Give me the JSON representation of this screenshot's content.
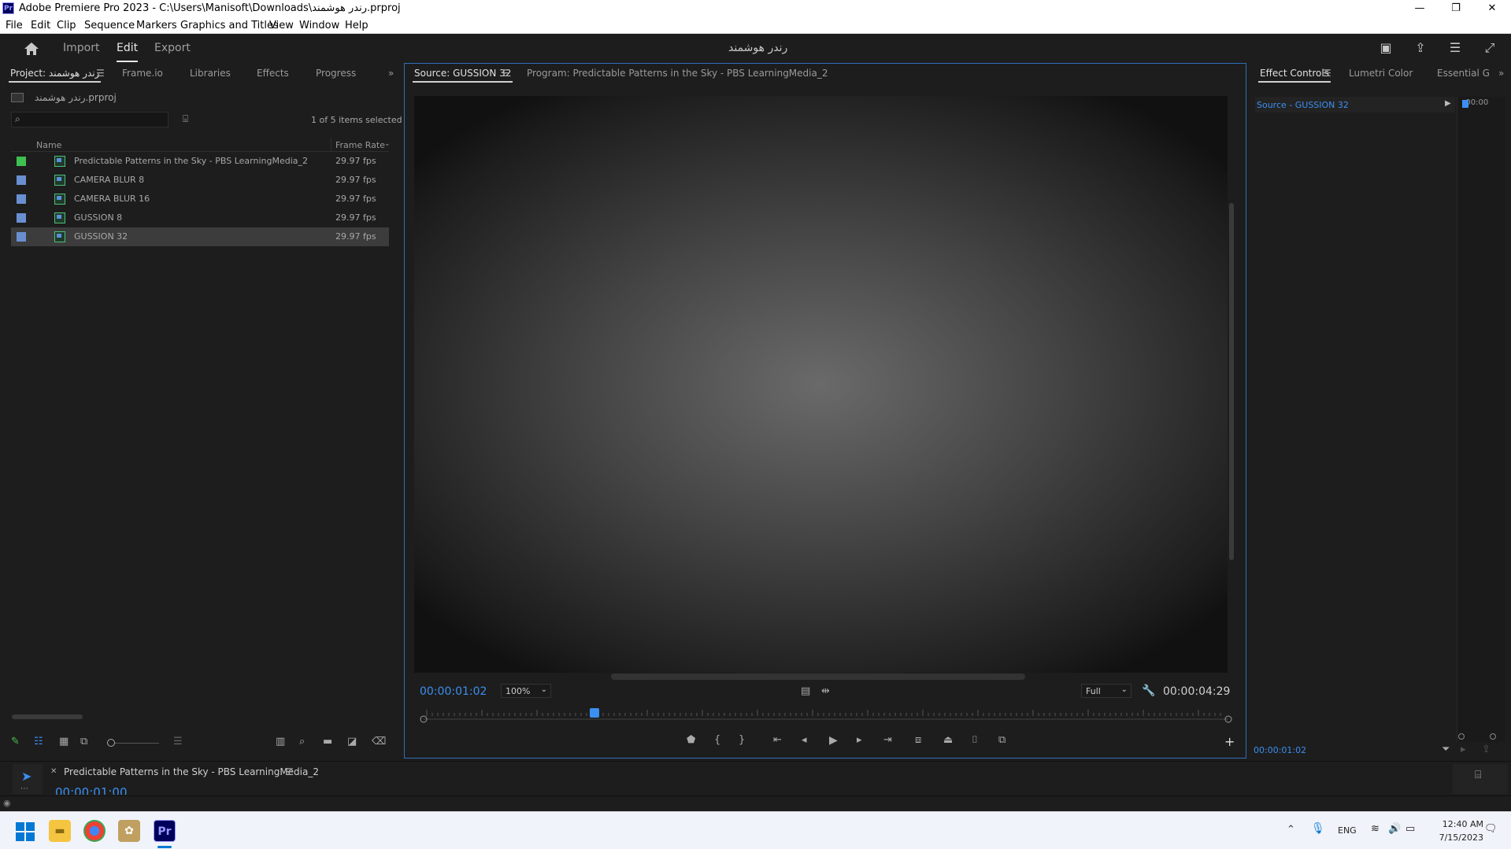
{
  "window": {
    "app_icon": "Pr",
    "title": "Adobe Premiere Pro 2023 - C:\\Users\\Manisoft\\Downloads\\رندر هوشمند.prproj",
    "minimize": "—",
    "maximize": "❐",
    "close": "✕"
  },
  "menu": [
    "File",
    "Edit",
    "Clip",
    "Sequence",
    "Markers",
    "Graphics and Titles",
    "View",
    "Window",
    "Help"
  ],
  "header": {
    "workspaces": [
      "Import",
      "Edit",
      "Export"
    ],
    "active_workspace": "Edit",
    "project_name": "رندر هوشمند"
  },
  "project_panel": {
    "tabs": [
      "Project: رندر هوشمند",
      "Frame.io",
      "Libraries",
      "Effects",
      "Progress"
    ],
    "overflow": "»",
    "bin_file": "رندر هوشمند.prproj",
    "search_placeholder": "",
    "selection_status": "1 of 5 items selected",
    "columns": {
      "name": "Name",
      "frame_rate": "Frame Rate"
    },
    "items": [
      {
        "name": "Predictable Patterns in the Sky - PBS LearningMedia_2",
        "frame_rate": "29.97 fps",
        "color": "#3fbf4f",
        "type": "sequence"
      },
      {
        "name": "CAMERA BLUR 8",
        "frame_rate": "29.97 fps",
        "color": "#6a8fd0",
        "type": "clip"
      },
      {
        "name": "CAMERA BLUR 16",
        "frame_rate": "29.97 fps",
        "color": "#6a8fd0",
        "type": "clip"
      },
      {
        "name": "GUSSION 8",
        "frame_rate": "29.97 fps",
        "color": "#6a8fd0",
        "type": "clip"
      },
      {
        "name": "GUSSION 32",
        "frame_rate": "29.97 fps",
        "color": "#6a8fd0",
        "type": "clip"
      }
    ]
  },
  "source_monitor": {
    "tabs": [
      "Source: GUSSION 32",
      "Program: Predictable Patterns in the Sky - PBS LearningMedia_2"
    ],
    "current_time": "00:00:01:02",
    "zoom": "100%",
    "resolution": "Full",
    "duration": "00:00:04:29",
    "playhead_fraction": 0.21
  },
  "effect_controls": {
    "tabs": [
      "Effect Controls",
      "Lumetri Color",
      "Essential G"
    ],
    "overflow": "»",
    "source_label": "Source - GUSSION 32",
    "timecode_ruler": ":00:00",
    "current_time": "00:00:01:02"
  },
  "timeline": {
    "tab": "Predictable Patterns in the Sky - PBS LearningMedia_2",
    "current_time": "00:00:01:00"
  },
  "taskbar": {
    "language": "ENG",
    "time": "12:40 AM",
    "date": "7/15/2023"
  }
}
